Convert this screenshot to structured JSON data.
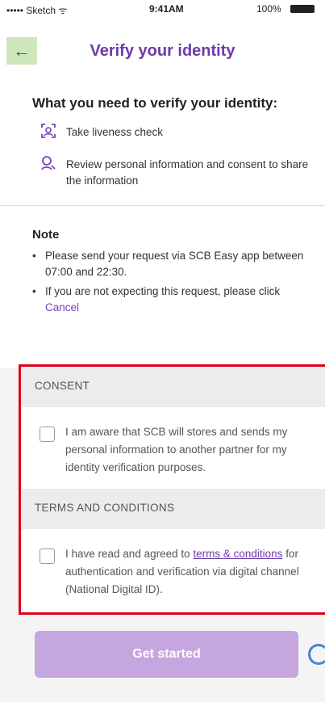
{
  "status_bar": {
    "carrier": "••••• Sketch ᯤ",
    "time": "9:41AM",
    "battery": "100%"
  },
  "header": {
    "back_glyph": "←",
    "title": "Verify your identity"
  },
  "requirements": {
    "heading": "What you need to verify your identity:",
    "items": [
      {
        "icon": "face-scan-icon",
        "label": "Take liveness check"
      },
      {
        "icon": "user-search-icon",
        "label": "Review personal information and consent to share the information"
      }
    ]
  },
  "note": {
    "heading": "Note",
    "items": [
      "Please send your request via SCB Easy app between 07:00 and 22:30.",
      "If you are not expecting this request, please click"
    ],
    "cancel_link": "Cancel"
  },
  "consent": {
    "header": "CONSENT",
    "text": "I am aware that SCB will stores and sends my personal information to another partner for my identity verification purposes."
  },
  "terms": {
    "header": "TERMS AND CONDITIONS",
    "text_before": "I have read and agreed to",
    "link": "terms & conditions",
    "text_after": "for authentication and verification via digital channel (National Digital ID)."
  },
  "cta": {
    "label": "Get started"
  },
  "colors": {
    "accent": "#6c3aa8",
    "back_button_bg": "#cfe7bd",
    "cta_bg": "#c6a6df",
    "highlight_border": "#e0001b"
  }
}
